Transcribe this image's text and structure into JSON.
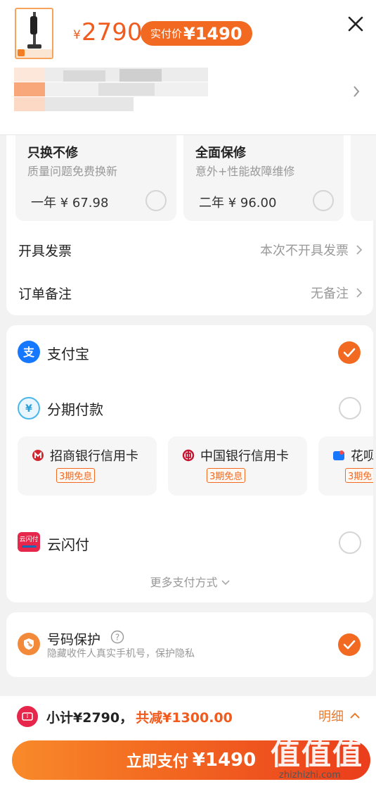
{
  "header": {
    "price_symbol": "¥",
    "price": "2790",
    "actual_label": "实付价",
    "actual_value": "¥1490"
  },
  "warranty": [
    {
      "title": "只换不修",
      "subtitle": "质量问题免费换新",
      "price": "一年 ¥ 67.98"
    },
    {
      "title": "全面保修",
      "subtitle": "意外+性能故障维修",
      "price": "二年 ¥ 96.00"
    }
  ],
  "invoice": {
    "label": "开具发票",
    "value": "本次不开具发票"
  },
  "remark": {
    "label": "订单备注",
    "value": "无备注"
  },
  "payment": {
    "alipay": "支付宝",
    "installment": "分期付款",
    "banks": [
      {
        "name": "招商银行信用卡",
        "badge": "3期免息"
      },
      {
        "name": "中国银行信用卡",
        "badge": "3期免息"
      },
      {
        "name": "花呗",
        "badge": "3期免"
      }
    ],
    "unionpay": "云闪付",
    "unionpay_logo_text": "云闪付",
    "more": "更多支付方式"
  },
  "privacy": {
    "title": "号码保护",
    "subtitle": "隐藏收件人真实手机号，保护隐私"
  },
  "footer": {
    "subtotal": "小计¥2790，",
    "reduction": "共减¥1300.00",
    "detail": "明细",
    "pay_label": "立即支付",
    "pay_amount": "¥1490"
  },
  "watermark": {
    "glyphs": "值值值",
    "url": "zhizhizhi.com"
  },
  "colors": {
    "accent": "#f26a21",
    "price": "#f15b1d",
    "alipay": "#1677ff",
    "unionpay": "#e6264a"
  }
}
